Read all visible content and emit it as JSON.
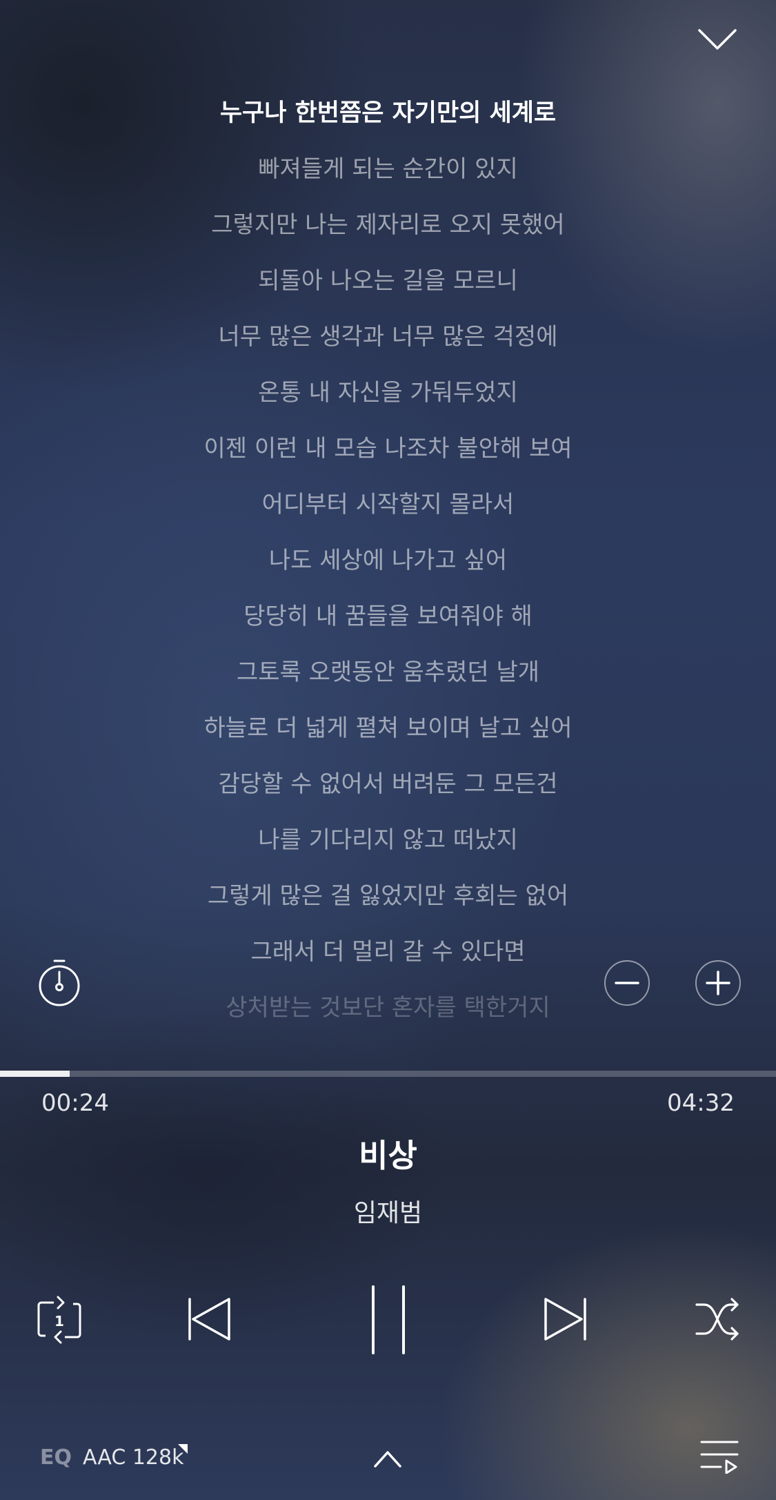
{
  "header": {
    "collapse_icon": "chevron-down-icon"
  },
  "lyrics": {
    "current_index": 0,
    "lines": [
      "누구나 한번쯤은 자기만의 세계로",
      "빠져들게 되는 순간이 있지",
      "그렇지만 나는 제자리로 오지 못했어",
      "되돌아 나오는 길을 모르니",
      "너무 많은 생각과 너무 많은 걱정에",
      "온통 내 자신을 가둬두었지",
      "이젠 이런 내 모습 나조차 불안해 보여",
      "어디부터 시작할지 몰라서",
      "나도 세상에 나가고 싶어",
      "당당히 내 꿈들을 보여줘야 해",
      "그토록 오랫동안 움추렸던 날개",
      "하늘로 더 넓게 펼쳐 보이며 날고 싶어",
      "감당할 수 없어서 버려둔 그 모든건",
      "나를 기다리지 않고 떠났지",
      "그렇게 많은 걸 잃었지만 후회는 없어",
      "그래서 더 멀리 갈 수 있다면",
      "상처받는 것보단 혼자를 택한거지"
    ]
  },
  "side_controls": {
    "timer_icon": "timer-icon",
    "zoom_out_icon": "minus-circle-icon",
    "zoom_in_icon": "plus-circle-icon"
  },
  "playback": {
    "elapsed": "00:24",
    "total": "04:32",
    "progress_fraction": 0.09
  },
  "track": {
    "title": "비상",
    "artist": "임재범"
  },
  "controls": {
    "repeat_icon": "repeat-one-icon",
    "repeat_badge": "1",
    "prev_icon": "skip-previous-icon",
    "pause_icon": "pause-icon",
    "next_icon": "skip-next-icon",
    "shuffle_icon": "shuffle-icon"
  },
  "bottom_bar": {
    "eq_label": "EQ",
    "quality_label": "AAC 128k",
    "expand_icon": "chevron-up-icon",
    "playlist_icon": "playlist-icon"
  }
}
